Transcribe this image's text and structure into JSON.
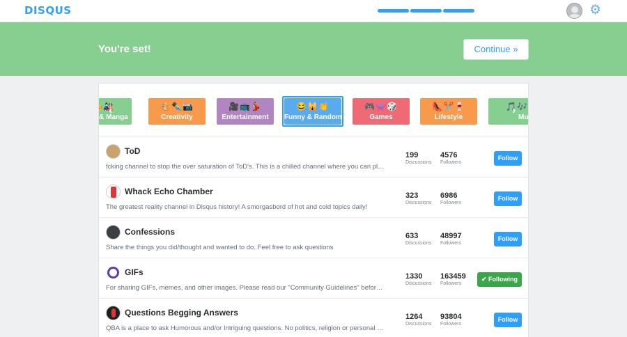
{
  "header": {
    "logo": "DISQUS",
    "progress_steps": 3,
    "gear_icon": "⚙"
  },
  "banner": {
    "title": "You're set!",
    "continue_label": "Continue »"
  },
  "categories": [
    {
      "label": "& Manga",
      "emoji": "🎭🎎",
      "color": "#86cf90"
    },
    {
      "label": "Creativity",
      "emoji": "🎨✒️📷",
      "color": "#f79a4b"
    },
    {
      "label": "Entertainment",
      "emoji": "🎥📺💃",
      "color": "#b085c2"
    },
    {
      "label": "Funny & Random",
      "emoji": "😂🙀👏",
      "color": "#5aaaf0"
    },
    {
      "label": "Games",
      "emoji": "🎮👾🎲",
      "color": "#ee6b75"
    },
    {
      "label": "Lifestyle",
      "emoji": "👠✂️🍷",
      "color": "#f79a4b"
    },
    {
      "label": "Mus",
      "emoji": "🎵🎶",
      "color": "#86cf90"
    }
  ],
  "channels": [
    {
      "name": "ToD",
      "description": "fcking channel to stop the over saturation of ToD's. This is a chilled channel where you can play ot...",
      "discussions": "199",
      "followers": "4576",
      "button": "Follow",
      "following": false
    },
    {
      "name": "Whack Echo Chamber",
      "description": "The greatest reality channel in Disqus history! A smorgasbord of hot and cold topics daily!",
      "discussions": "323",
      "followers": "6986",
      "button": "Follow",
      "following": false
    },
    {
      "name": "Confessions",
      "description": "Share the things you did/thought and wanted to do. Feel free to ask questions",
      "discussions": "633",
      "followers": "48997",
      "button": "Follow",
      "following": false
    },
    {
      "name": "GIFs",
      "description": "For sharing GIFs, memes, and other images. Please read our \"Community Guidelines\" before openi...",
      "discussions": "1330",
      "followers": "163459",
      "button": "Following",
      "following": true
    },
    {
      "name": "Questions Begging Answers",
      "description": "QBA is a place to ask Humorous and/or Intriguing questions. No politics, religion or personal advic...",
      "discussions": "1264",
      "followers": "93804",
      "button": "Follow",
      "following": false
    }
  ],
  "labels": {
    "discussions": "Discussions",
    "followers": "Followers",
    "check": "✔"
  }
}
